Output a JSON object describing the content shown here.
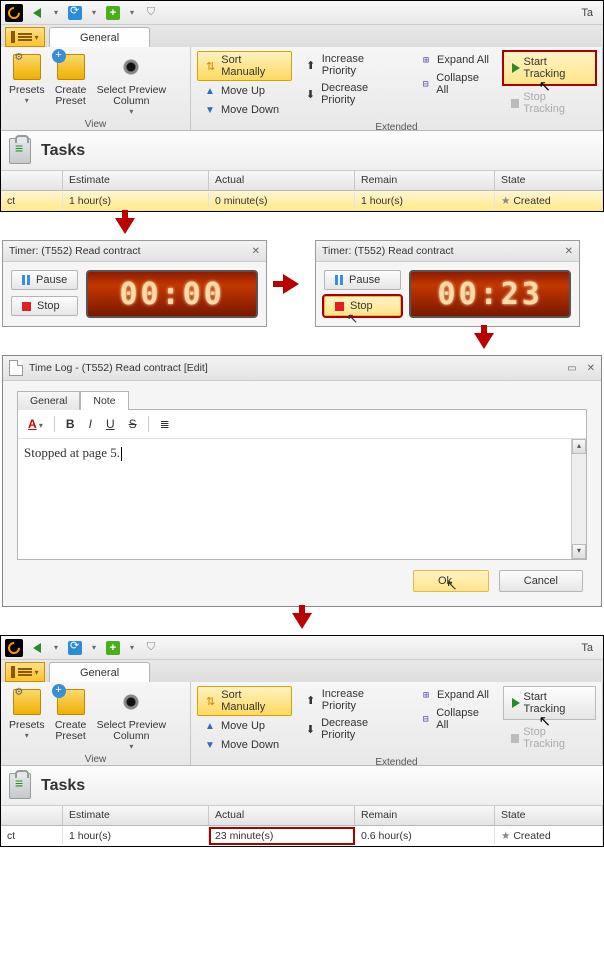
{
  "app_title_suffix": "Ta",
  "tab": {
    "general": "General"
  },
  "ribbon": {
    "presets": "Presets",
    "create_preset": "Create\nPreset",
    "select_preview": "Select Preview\nColumn",
    "group_view": "View",
    "sort_manually": "Sort Manually",
    "move_up": "Move Up",
    "move_down": "Move Down",
    "increase_priority": "Increase Priority",
    "decrease_priority": "Decrease Priority",
    "expand_all": "Expand All",
    "collapse_all": "Collapse All",
    "start_tracking": "Start Tracking",
    "stop_tracking": "Stop Tracking",
    "group_extended": "Extended"
  },
  "tasks": {
    "title": "Tasks",
    "col_estimate": "Estimate",
    "col_actual": "Actual",
    "col_remain": "Remain",
    "col_state": "State",
    "row1": {
      "name": "ct",
      "estimate": "1 hour(s)",
      "actual": "0 minute(s)",
      "remain": "1 hour(s)",
      "state": "Created"
    },
    "row2": {
      "name": "ct",
      "estimate": "1 hour(s)",
      "actual": "23 minute(s)",
      "remain": "0.6 hour(s)",
      "state": "Created"
    }
  },
  "timer": {
    "title": "Timer: (T552) Read contract",
    "pause": "Pause",
    "stop": "Stop",
    "time_zero": "00:00",
    "time_23": "00:23"
  },
  "timelog": {
    "title": "Time Log - (T552) Read contract [Edit]",
    "tab_general": "General",
    "tab_note": "Note",
    "note_text": "Stopped at page 5.",
    "ok": "Ok",
    "cancel": "Cancel",
    "font_a": "A",
    "b": "B",
    "i": "I",
    "u": "U",
    "s": "S"
  }
}
